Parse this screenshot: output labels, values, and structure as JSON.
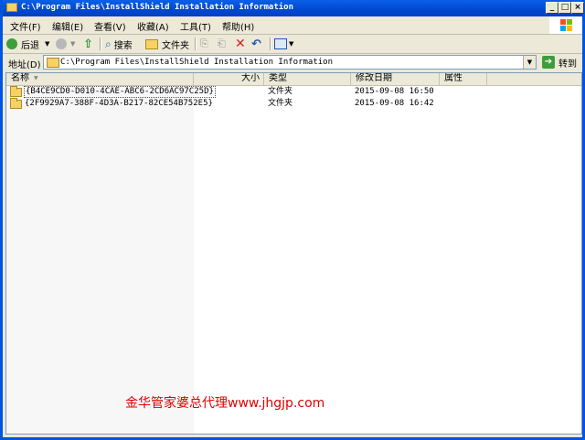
{
  "window": {
    "title": "C:\\Program Files\\InstallShield Installation Information",
    "minimize": "_",
    "maximize": "□",
    "close": "×"
  },
  "menubar": {
    "items": [
      "文件(F)",
      "编辑(E)",
      "查看(V)",
      "收藏(A)",
      "工具(T)",
      "帮助(H)"
    ]
  },
  "toolbar": {
    "back_label": "后退",
    "search_label": "搜索",
    "folders_label": "文件夹"
  },
  "address": {
    "label": "地址(D)",
    "value": "C:\\Program Files\\InstallShield Installation Information",
    "go_label": "转到"
  },
  "list": {
    "columns": [
      "名称",
      "大小",
      "类型",
      "修改日期",
      "属性"
    ],
    "rows": [
      {
        "name": "{B4CE9CD0-D010-4CAE-ABC6-2CD6AC97C25D}",
        "size": "",
        "type": "文件夹",
        "modified": "2015-09-08 16:50",
        "attributes": ""
      },
      {
        "name": "{2F9929A7-388F-4D3A-B217-82CE54B752E5}",
        "size": "",
        "type": "文件夹",
        "modified": "2015-09-08 16:42",
        "attributes": ""
      }
    ]
  },
  "watermark": "金华管家婆总代理www.jhgjp.com",
  "colors": {
    "titlebar": "#0054e3",
    "watermark": "#e00000"
  }
}
